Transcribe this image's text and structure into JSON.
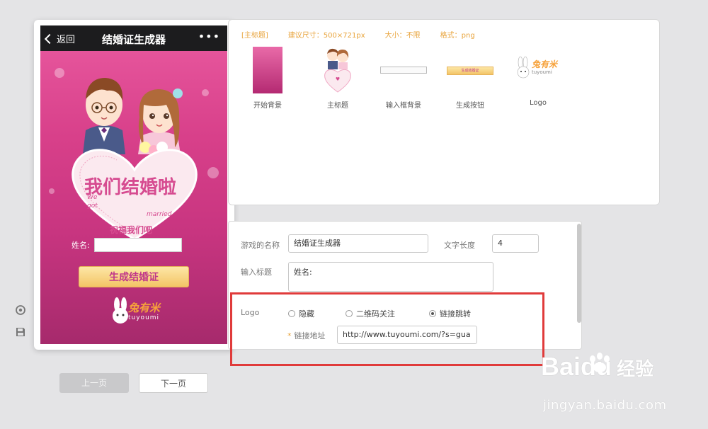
{
  "phone": {
    "back_label": "返回",
    "title": "结婚证生成器",
    "more_label": "•••",
    "heart_title": "我们结婚啦",
    "heart_en_1": "We",
    "heart_en_2": "got",
    "heart_en_3": "married",
    "heart_subtitle": "祝福我们吧",
    "name_label": "姓名:",
    "generate_label": "生成结婚证",
    "logo_text": "兔有米",
    "logo_sub": "tuyoumi"
  },
  "assets": {
    "info": {
      "tag": "[主标题]",
      "size_hint": "建议尺寸：500×721px",
      "file_size": "大小：不限",
      "format": "格式：png"
    },
    "items": [
      {
        "caption": "开始背景"
      },
      {
        "caption": "主标题"
      },
      {
        "caption": "输入框背景"
      },
      {
        "caption": "生成按钮"
      },
      {
        "caption": "Logo"
      }
    ],
    "mini_button_label": "生成结婚证"
  },
  "form": {
    "game_name_label": "游戏的名称",
    "game_name_value": "结婚证生成器",
    "text_length_label": "文字长度",
    "text_length_value": "4",
    "input_title_label": "输入标题",
    "input_title_value": "姓名:",
    "logo_label": "Logo",
    "radio_hide": "隐藏",
    "radio_qr": "二维码关注",
    "radio_link": "链接跳转",
    "link_label": "链接地址",
    "link_value": "http://www.tuyoumi.com/?s=gua"
  },
  "nav": {
    "prev_label": "上一页",
    "next_label": "下一页"
  },
  "watermark": {
    "brand": "Baidu",
    "brand_cn": "经验",
    "url": "jingyan.baidu.com"
  },
  "colors": {
    "accent_orange": "#e8a33a",
    "highlight_red": "#e03b3b",
    "phone_pink": "#d8408a"
  }
}
